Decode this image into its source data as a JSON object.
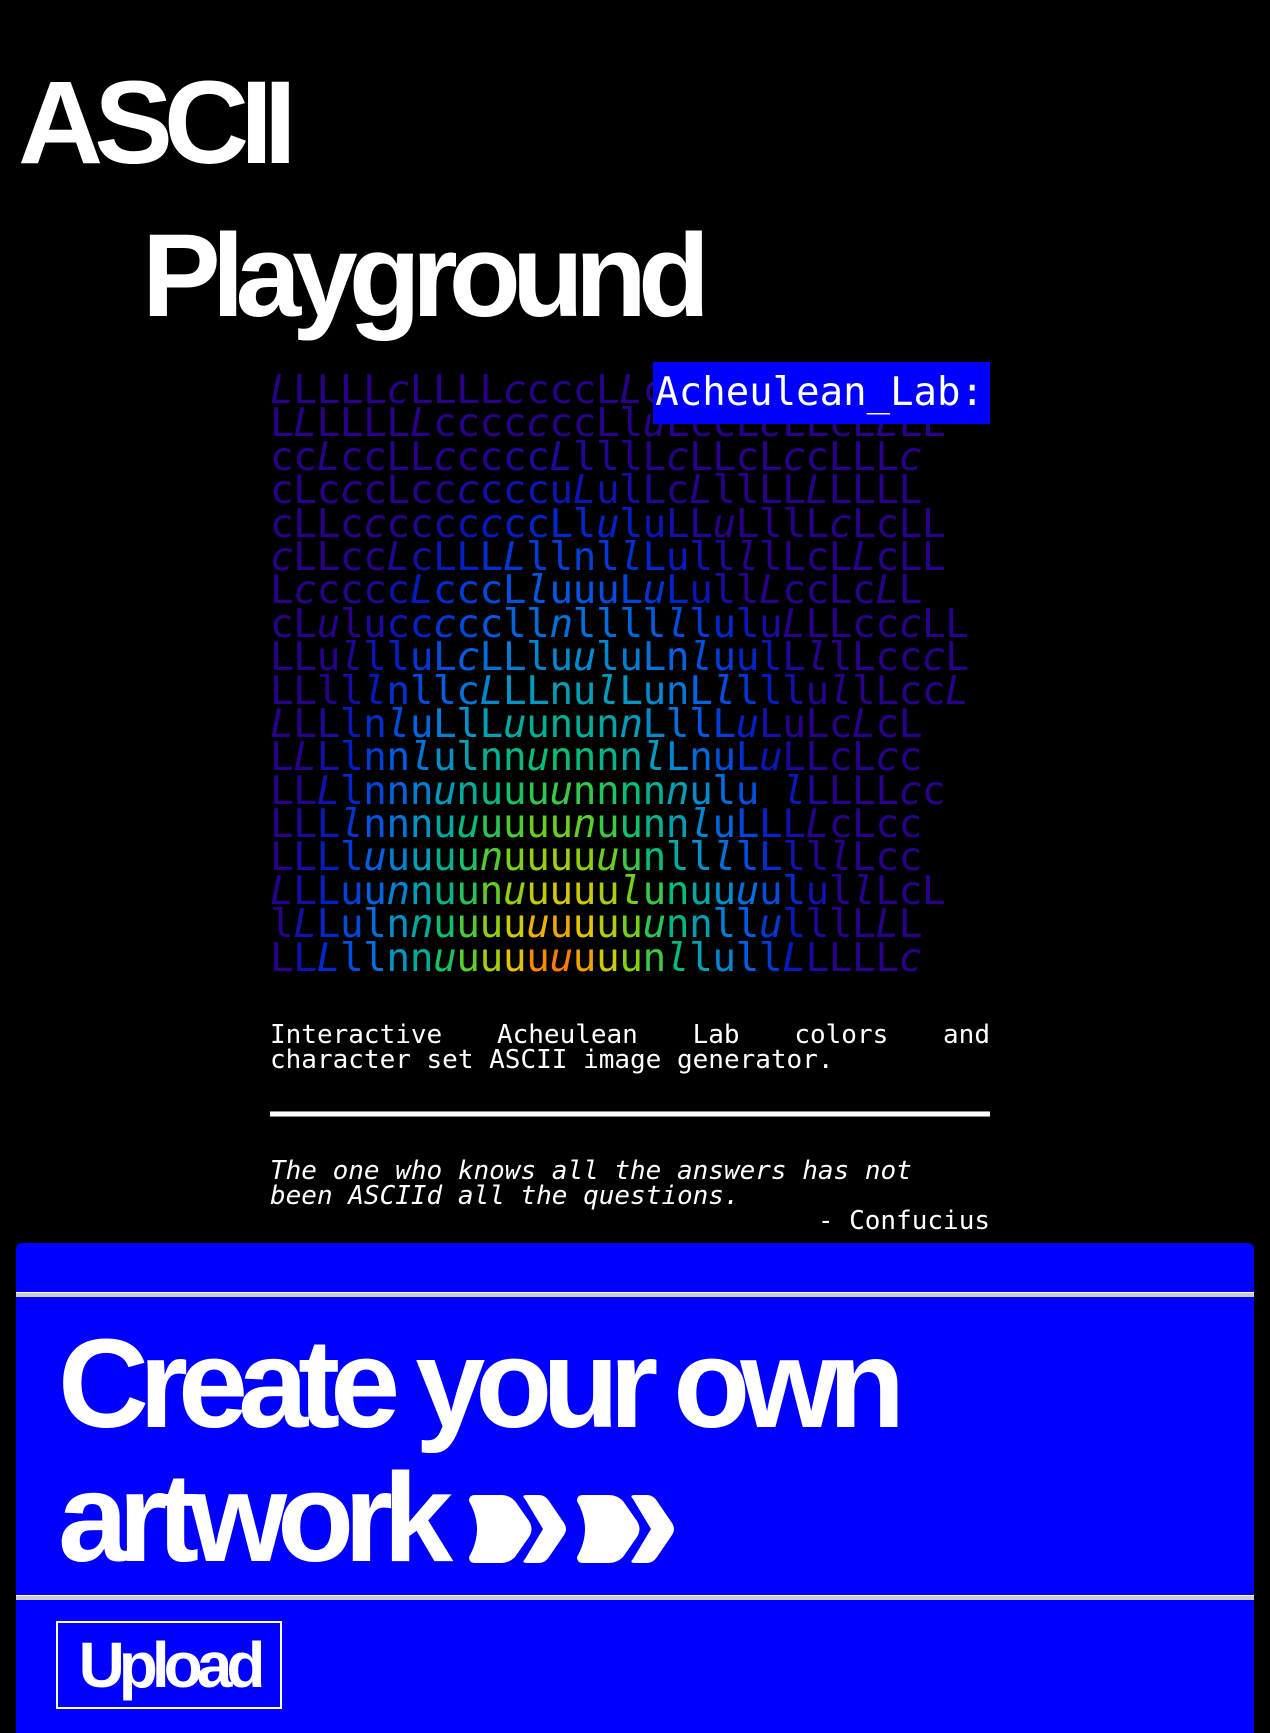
{
  "title": {
    "line1": "ASCII",
    "line2": "Playground"
  },
  "ascii_art": {
    "tag": "Acheulean_Lab:",
    "rows": [
      "LLLLLcLLLLccccLLccLLLLLcLLLL",
      "LLLLLLLcccccccLluLccLcLLcLLLL",
      "ccLccLLcccccLlllLcLLcLccLLLc",
      "cLcccLccccccuLulLcLllLLLLLLL",
      "cLLcccccccccLluluLLuLllLcLcLL",
      "cLLccLcLLLLllnllLullllLcLLcLL",
      "LcccccLcccLluuuLuLullLccLcLL",
      "cLulucccccllnlllllluluLLLcccLL",
      "LLullluLcLLluuluLnluulLllLcccL",
      "LLlllnllcLLLnulLunLllllullLccL",
      "LLLlnluLlLuununnLllLuLuLcLcL",
      "LLLlnnlulnnunnnnlLnuLuLLcLcc",
      "LLLlnnnunuuuunnnnnulu lLLLLcc",
      "LLLlnnnuuuuuunuunnluLLLLcLcc",
      "LLLluuuuunuuuuuunllllLlllLcc",
      "LLLuunnuunuuuuulunuuuulullLcL",
      "lLLulnnuuuuuuuuuunnllulllLLL",
      "LLLllnnuuuuuuuuunllullLLLLLc"
    ]
  },
  "description": "Interactive Acheulean Lab colors and character set ASCII image generator.",
  "quote": {
    "text": "The one who knows all the answers has not been ASCIId all the questions.",
    "author": "- Confucius"
  },
  "cta": {
    "heading_line1": "Create your own",
    "heading_line2": "artwork",
    "arrow_icon": "double-arrow-right-icon",
    "upload_label": "Upload"
  },
  "colors": {
    "background": "#000000",
    "accent_blue": "#0000ff",
    "text": "#ffffff"
  }
}
